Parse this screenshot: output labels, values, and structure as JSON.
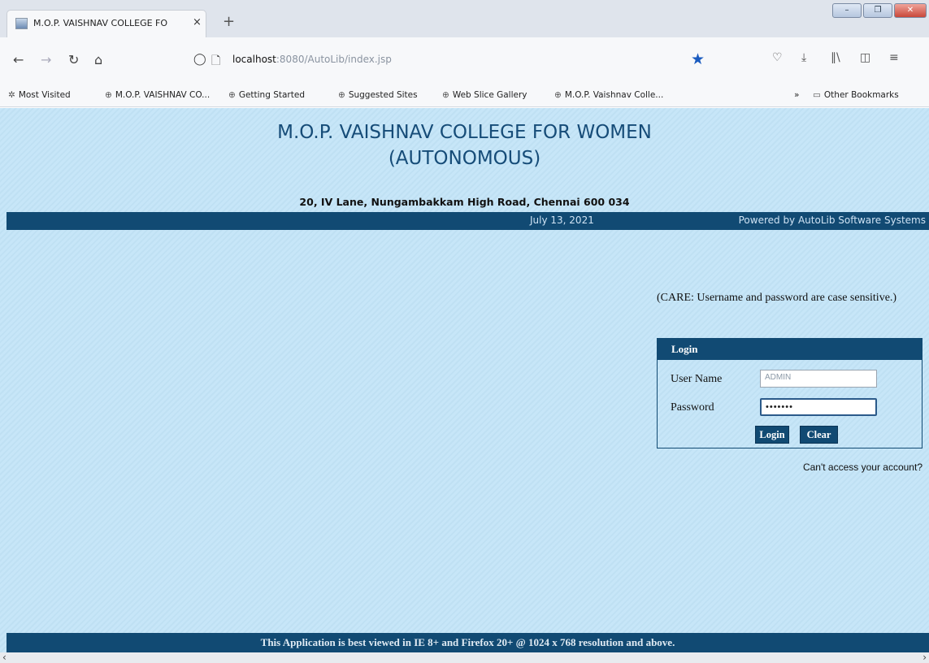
{
  "browser": {
    "tab_title": "M.O.P. VAISHNAV COLLEGE FO",
    "tab_close": "×",
    "new_tab": "+",
    "url_host": "localhost",
    "url_rest": ":8080/AutoLib/index.jsp",
    "window_minimize": "–",
    "window_maximize": "❐",
    "window_close": "✕"
  },
  "bookmarks": [
    {
      "label": "Most Visited",
      "icon": "gear-icon"
    },
    {
      "label": "M.O.P. VAISHNAV CO...",
      "icon": "globe-icon"
    },
    {
      "label": "Getting Started",
      "icon": "globe-icon"
    },
    {
      "label": "Suggested Sites",
      "icon": "globe-icon"
    },
    {
      "label": "Web Slice Gallery",
      "icon": "globe-icon"
    },
    {
      "label": "M.O.P. Vaishnav Colle...",
      "icon": "globe-icon"
    }
  ],
  "bookmarks_overflow": "»",
  "other_bookmarks": "Other Bookmarks",
  "header": {
    "college_line1": "M.O.P. VAISHNAV COLLEGE FOR WOMEN",
    "college_line2": "(AUTONOMOUS)",
    "address": "20, IV Lane, Nungambakkam High Road, Chennai 600 034",
    "date": "July 13, 2021",
    "powered_by": "Powered by AutoLib Software Systems"
  },
  "login": {
    "care_note": "(CARE: Username and password are case sensitive.)",
    "heading": "Login",
    "username_label": "User Name",
    "username_value": "ADMIN",
    "password_label": "Password",
    "password_value": "•••••••",
    "login_button": "Login",
    "clear_button": "Clear",
    "cant_access": "Can't access your account?"
  },
  "footer": {
    "text": "This Application is best viewed in IE 8+ and Firefox 20+ @ 1024 x 768 resolution and above."
  },
  "colors": {
    "page_bg": "#c7e6f8",
    "brand_navy": "#114a73",
    "title_blue": "#164c78",
    "bookmark_star": "#1a5bbf"
  }
}
